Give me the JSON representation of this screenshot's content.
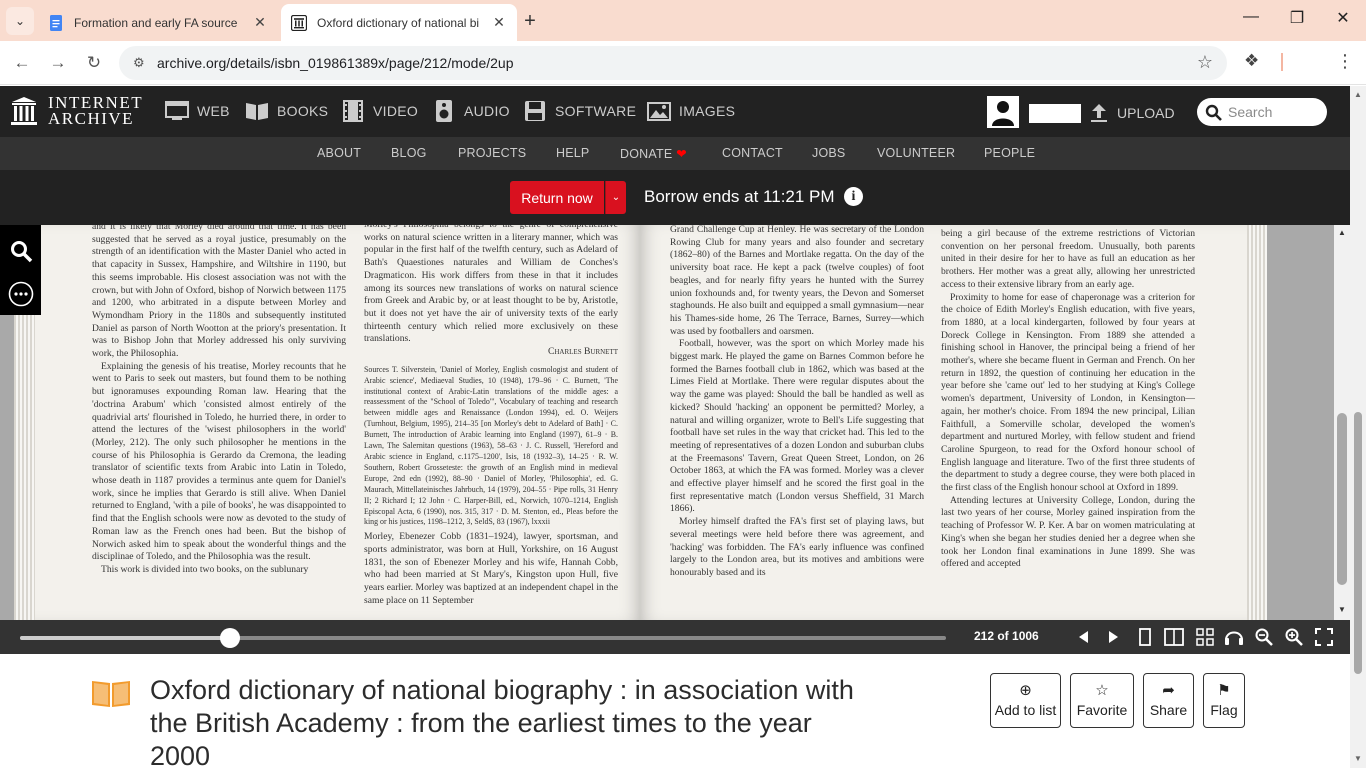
{
  "browser": {
    "tabs": [
      {
        "title": "Formation and early FA source",
        "active": false
      },
      {
        "title": "Oxford dictionary of national bi",
        "active": true
      }
    ],
    "url": "archive.org/details/isbn_019861389x/page/212/mode/2up"
  },
  "ia_header": {
    "logo_line1": "INTERNET",
    "logo_line2": "ARCHIVE",
    "media": [
      "WEB",
      "BOOKS",
      "VIDEO",
      "AUDIO",
      "SOFTWARE",
      "IMAGES"
    ],
    "upload": "UPLOAD",
    "search_placeholder": "Search",
    "subnav": [
      "ABOUT",
      "BLOG",
      "PROJECTS",
      "HELP",
      "DONATE",
      "CONTACT",
      "JOBS",
      "VOLUNTEER",
      "PEOPLE"
    ]
  },
  "borrow": {
    "return_label": "Return now",
    "ends_text": "Borrow ends at 11:21 PM"
  },
  "reader": {
    "page_count": "212 of 1006",
    "progress": 0.227,
    "col1": [
      "and it is likely that Morley died around that time. It has been suggested that he served as a royal justice, presumably on the strength of an identification with the Master Daniel who acted in that capacity in Sussex, Hampshire, and Wiltshire in 1190, but this seems improbable. His closest association was not with the crown, but with John of Oxford, bishop of Norwich between 1175 and 1200, who arbitrated in a dispute between Morley and Wymondham Priory in the 1180s and subsequently instituted Daniel as parson of North Wootton at the priory's presentation. It was to Bishop John that Morley addressed his only surviving work, the Philosophia.",
      "Explaining the genesis of his treatise, Morley recounts that he went to Paris to seek out masters, but found them to be nothing but ignoramuses expounding Roman law. Hearing that the 'doctrina Arabum' which 'consisted almost entirely of the quadrivial arts' flourished in Toledo, he hurried there, in order to attend the lectures of the 'wisest philosophers in the world' (Morley, 212). The only such philosopher he mentions in the course of his Philosophia is Gerardo da Cremona, the leading translator of scientific texts from Arabic into Latin in Toledo, whose death in 1187 provides a terminus ante quem for Daniel's work, since he implies that Gerardo is still alive. When Daniel returned to England, 'with a pile of books', he was disappointed to find that the English schools were now as devoted to the study of Roman law as the French ones had been. But the bishop of Norwich asked him to speak about the wonderful things and the disciplinae of Toledo, and the Philosophia was the result.",
      "This work is divided into two books, on the sublunary"
    ],
    "col2": [
      "Morley's Philosophia belongs to the genre of comprehensive works on natural science written in a literary manner, which was popular in the first half of the twelfth century, such as Adelard of Bath's Quaestiones naturales and William de Conches's Dragmaticon. His work differs from these in that it includes among its sources new translations of works on natural science from Greek and Arabic by, or at least thought to be by, Aristotle, but it does not yet have the air of university texts of the early thirteenth century which relied more exclusively on these translations."
    ],
    "col2_signature": "Charles Burnett",
    "col2_sources": "Sources T. Silverstein, 'Daniel of Morley, English cosmologist and student of Arabic science', Mediaeval Studies, 10 (1948), 179–96 · C. Burnett, 'The institutional context of Arabic-Latin translations of the middle ages: a reassessment of the \"School of Toledo\"', Vocabulary of teaching and research between middle ages and Renaissance (London 1994), ed. O. Weijers (Turnhout, Belgium, 1995), 214–35 [on Morley's debt to Adelard of Bath] · C. Burnett, The introduction of Arabic learning into England (1997), 61–9 · B. Lawn, The Salernitan questions (1963), 58–63 · J. C. Russell, 'Hereford and Arabic science in England, c.1175–1200', Isis, 18 (1932–3), 14–25 · R. W. Southern, Robert Grosseteste: the growth of an English mind in medieval Europe, 2nd edn (1992), 88–90 · Daniel of Morley, 'Philosophia', ed. G. Maurach, Mittellateinisches Jahrbuch, 14 (1979), 204–55 · Pipe rolls, 31 Henry II; 2 Richard I; 12 John · C. Harper-Bill, ed., Norwich, 1070–1214, English Episcopal Acta, 6 (1990), nos. 315, 317 · D. M. Stenton, ed., Pleas before the king or his justices, 1198–1212, 3, SeldS, 83 (1967), lxxxii",
    "col2_b": "Morley, Ebenezer Cobb (1831–1924), lawyer, sportsman, and sports administrator, was born at Hull, Yorkshire, on 16 August 1831, the son of Ebenezer Morley and his wife, Hannah Cobb, who had been married at St Mary's, Kingston upon Hull, five years earlier. Morley was baptized at an independent chapel in the same place on 11 September",
    "col3": [
      "Grand Challenge Cup at Henley. He was secretary of the London Rowing Club for many years and also founder and secretary (1862–80) of the Barnes and Mortlake regatta. On the day of the university boat race. He kept a pack (twelve couples) of foot beagles, and for nearly fifty years he hunted with the Surrey union foxhounds and, for twenty years, the Devon and Somerset staghounds. He also built and equipped a small gymnasium—near his Thames-side home, 26 The Terrace, Barnes, Surrey—which was used by footballers and oarsmen.",
      "Football, however, was the sport on which Morley made his biggest mark. He played the game on Barnes Common before he formed the Barnes football club in 1862, which was based at the Limes Field at Mortlake. There were regular disputes about the way the game was played: Should the ball be handled as well as kicked? Should 'hacking' an opponent be permitted? Morley, a natural and willing organizer, wrote to Bell's Life suggesting that football have set rules in the way that cricket had. This led to the meeting of representatives of a dozen London and suburban clubs at the Freemasons' Tavern, Great Queen Street, London, on 26 October 1863, at which the FA was formed. Morley was a clever and effective player himself and he scored the first goal in the first representative match (London versus Sheffield, 31 March 1866).",
      "Morley himself drafted the FA's first set of playing laws, but several meetings were held before there was agreement, and 'hacking' was forbidden. The FA's early influence was confined largely to the London area, but its motives and ambitions were honourably based and its"
    ],
    "col4": [
      "being a girl because of the extreme restrictions of Victorian convention on her personal freedom. Unusually, both parents united in their desire for her to have as full an education as her brothers. Her mother was a great ally, allowing her unrestricted access to their extensive library from an early age.",
      "Proximity to home for ease of chaperonage was a criterion for the choice of Edith Morley's English education, with five years, from 1880, at a local kindergarten, followed by four years at Doreck College in Kensington. From 1889 she attended a finishing school in Hanover, the principal being a friend of her mother's, where she became fluent in German and French. On her return in 1892, the question of continuing her education in the year before she 'came out' led to her studying at King's College women's department, University of London, in Kensington—again, her mother's choice. From 1894 the new principal, Lilian Faithfull, a Somerville scholar, developed the women's department and nurtured Morley, with fellow student and friend Caroline Spurgeon, to read for the Oxford honour school of English language and literature. Two of the first three students of the department to study a degree course, they were both placed in the first class of the English honour school at Oxford in 1899.",
      "Attending lectures at University College, London, during the last two years of her course, Morley gained inspiration from the teaching of Professor W. P. Ker. A bar on women matriculating at King's when she began her studies denied her a degree when she took her London final examinations in June 1899. She was offered and accepted"
    ]
  },
  "item": {
    "title": "Oxford dictionary of national biography : in association with the British Academy : from the earliest times to the year 2000",
    "actions": [
      "Add to list",
      "Favorite",
      "Share",
      "Flag"
    ]
  },
  "colors": {
    "tabstrip": "#f9dccf",
    "ia_dark": "#222222",
    "return_red": "#d9111f",
    "book_icon": "#f29b2d"
  }
}
